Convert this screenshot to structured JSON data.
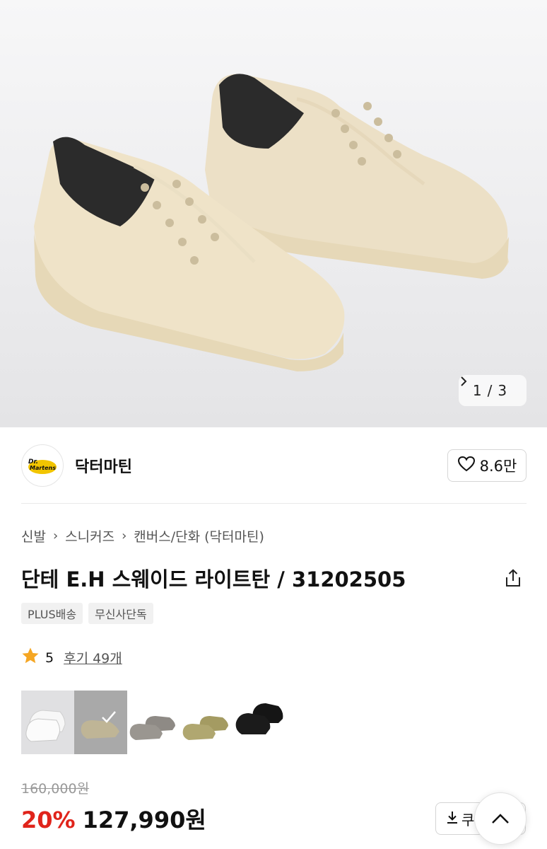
{
  "gallery": {
    "pager_current": "1",
    "pager_sep": "/",
    "pager_total": "3",
    "pager_next_icon": "chevron-right-icon"
  },
  "brand": {
    "name": "닥터마틴",
    "logo_text": "Dr. Martens",
    "like_count": "8.6만",
    "like_icon": "heart-outline-icon"
  },
  "breadcrumb": [
    "신발",
    "스니커즈",
    "캔버스/단화 (닥터마틴)"
  ],
  "product": {
    "title": "단테 E.H 스웨이드 라이트탄 / 31202505",
    "share_icon": "share-icon"
  },
  "tags": [
    "PLUS배송",
    "무신사단독"
  ],
  "rating": {
    "icon": "star-icon",
    "score": "5",
    "reviews_label": "후기 49개",
    "star_color": "#f5a623"
  },
  "color_options": [
    {
      "name": "white",
      "color": "#f2f2f2",
      "selected": false
    },
    {
      "name": "khaki-tan",
      "color": "#b4a98a",
      "selected": true
    },
    {
      "name": "grey",
      "color": "#8f8b86",
      "selected": false
    },
    {
      "name": "olive",
      "color": "#a9a06a",
      "selected": false
    },
    {
      "name": "black",
      "color": "#161616",
      "selected": false
    }
  ],
  "price": {
    "original": "160,000원",
    "discount": "20%",
    "current": "127,990원",
    "discount_color": "#e0241b"
  },
  "actions": {
    "coupon_label": "쿠",
    "coupon_icon": "download-icon",
    "scroll_top_icon": "chevron-up-icon"
  }
}
